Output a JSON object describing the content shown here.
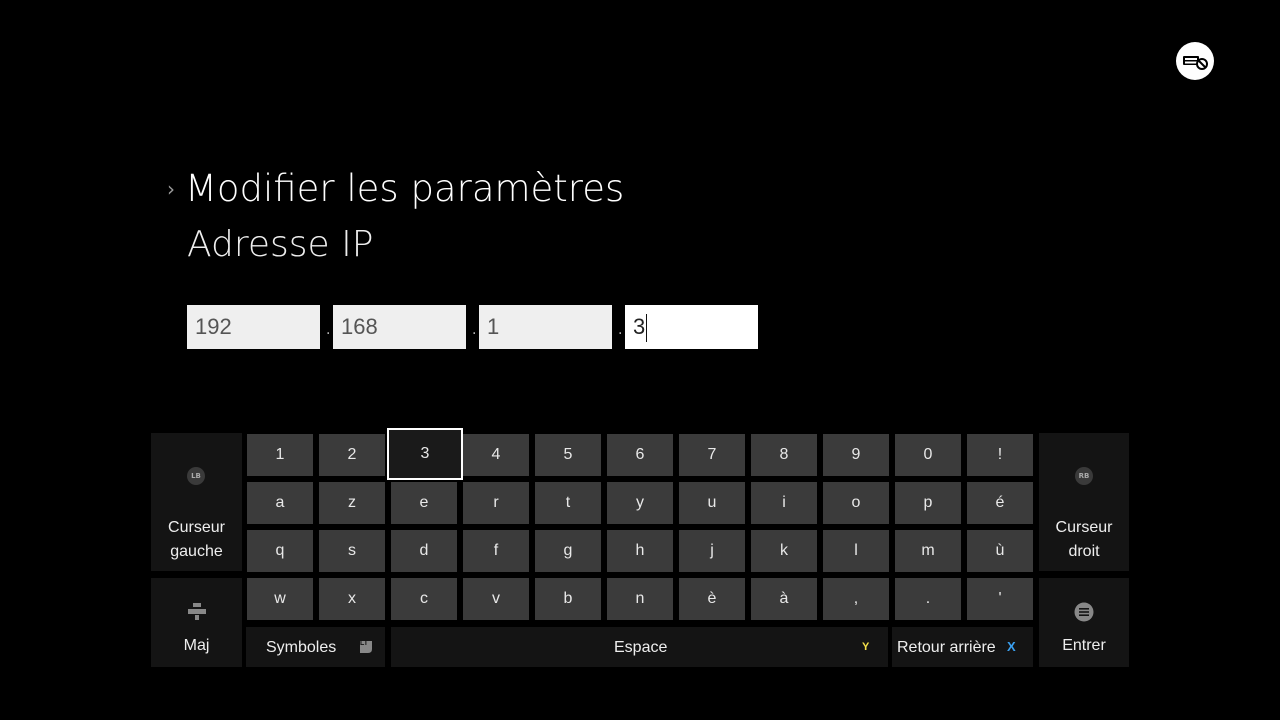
{
  "status": {
    "icon": "network-disconnected-icon"
  },
  "header": {
    "chevron": "›",
    "title": "Modifier les paramètres",
    "subtitle": "Adresse IP"
  },
  "ip": {
    "octets": [
      "192",
      "168",
      "1",
      "3"
    ],
    "separator": "."
  },
  "keyboard": {
    "rows": [
      [
        "1",
        "2",
        "3",
        "4",
        "5",
        "6",
        "7",
        "8",
        "9",
        "0",
        "!"
      ],
      [
        "a",
        "z",
        "e",
        "r",
        "t",
        "y",
        "u",
        "i",
        "o",
        "p",
        "é"
      ],
      [
        "q",
        "s",
        "d",
        "f",
        "g",
        "h",
        "j",
        "k",
        "l",
        "m",
        "ù"
      ],
      [
        "w",
        "x",
        "c",
        "v",
        "b",
        "n",
        "è",
        "à",
        ",",
        ".",
        "'"
      ]
    ],
    "focused_key": "3",
    "left_cursor": {
      "button": "LB",
      "line1": "Curseur",
      "line2": "gauche"
    },
    "right_cursor": {
      "button": "RB",
      "line1": "Curseur",
      "line2": "droit"
    },
    "shift": {
      "icon": "shift-icon",
      "label": "Maj"
    },
    "symbols": {
      "label": "Symboles",
      "button": "LT"
    },
    "space": {
      "label": "Espace",
      "button": "Y"
    },
    "backspace": {
      "label": "Retour arrière",
      "button": "X"
    },
    "enter": {
      "icon": "menu-button-icon",
      "label": "Entrer"
    }
  },
  "colors": {
    "background": "#000000",
    "key": "#3b3b3b",
    "y_button": "#f5e14a",
    "x_button": "#3aa0f0"
  }
}
